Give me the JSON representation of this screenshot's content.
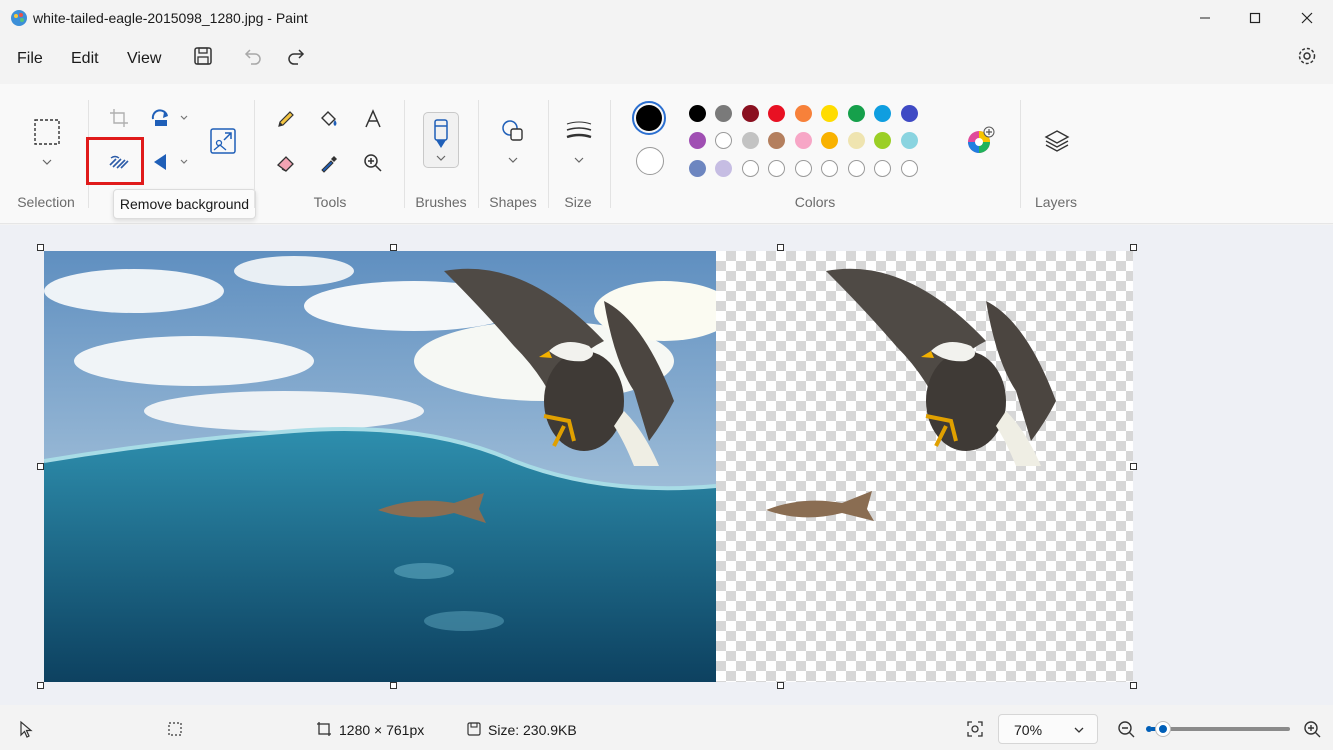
{
  "window": {
    "title": "white-tailed-eagle-2015098_1280.jpg - Paint",
    "minimize_icon": "minimize-icon",
    "maximize_icon": "maximize-icon",
    "close_icon": "close-icon"
  },
  "menu": {
    "file": "File",
    "edit": "Edit",
    "view": "View"
  },
  "ribbon": {
    "groups": {
      "selection": "Selection",
      "tools": "Tools",
      "brushes": "Brushes",
      "shapes": "Shapes",
      "size": "Size",
      "colors": "Colors",
      "layers": "Layers"
    },
    "tooltip": "Remove background"
  },
  "colors": {
    "primary": "#000000",
    "secondary": "#ffffff",
    "accent": "#005fb8",
    "highlight": "#e01b1b",
    "palette_row1": [
      "#000000",
      "#7a7a7a",
      "#8a1020",
      "#e81123",
      "#f7813a",
      "#ffdc00",
      "#16a04b",
      "#0f9ee0",
      "#3f4ac4"
    ],
    "palette_row2": [
      "#a04fb3",
      "#ffffff",
      "#c3c3c3",
      "#b47f5e",
      "#f7a6c6",
      "#f9b200",
      "#efe4b0",
      "#9bcf26",
      "#8ad4e0"
    ],
    "palette_row3": [
      "#6d86c0",
      "#c6bde3",
      "",
      "",
      "",
      "",
      "",
      "",
      ""
    ]
  },
  "status": {
    "dimensions": "1280 × 761px",
    "size": "Size: 230.9KB",
    "zoom": "70%",
    "zoom_level": 0.1
  }
}
